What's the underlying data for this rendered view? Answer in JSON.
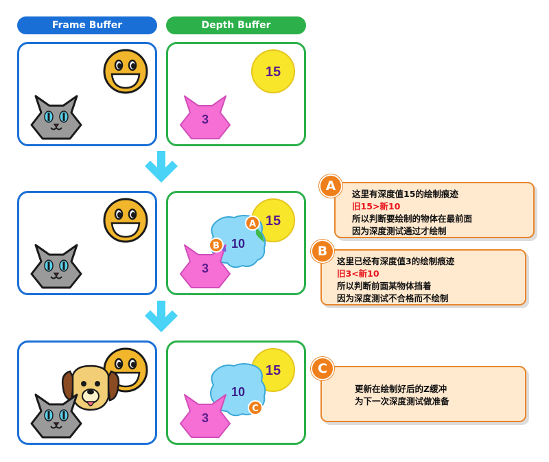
{
  "headers": {
    "frame": "Frame Buffer",
    "depth": "Depth Buffer"
  },
  "colors": {
    "frame": "#1a6fd6",
    "depth": "#2bb04a",
    "arrow": "#48d3f7",
    "note_border": "#e8862a",
    "note_fill": "#ffe9cf",
    "badge": "#ef7f1a",
    "cat_depth": "#f56fd5",
    "ball_depth": "#f7e62a",
    "dog_depth": "#8ed9f7"
  },
  "depth_values": {
    "ball": "15",
    "cat": "3",
    "dog": "10"
  },
  "markers": {
    "a": "A",
    "b": "B",
    "c": "C"
  },
  "notes": {
    "a": {
      "badge": "A",
      "line1": "这里有深度值15的绘制痕迹",
      "line2": "旧15>新10",
      "line3": "所以判断要绘制的物体在最前面",
      "line4": "因为深度测试通过才绘制"
    },
    "b": {
      "badge": "B",
      "line1": "这里已经有深度值3的绘制痕迹",
      "line2": "旧3<新10",
      "line3": "所以判断前面某物体挡着",
      "line4": "因为深度测试不合格而不绘制"
    },
    "c": {
      "badge": "C",
      "line1": "更新在绘制好后的Z缓冲",
      "line2": "为下一次深度测试做准备"
    }
  }
}
